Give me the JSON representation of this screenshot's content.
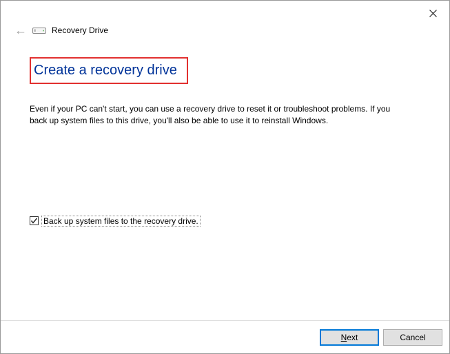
{
  "window": {
    "title": "Recovery Drive"
  },
  "page": {
    "heading": "Create a recovery drive",
    "description": "Even if your PC can't start, you can use a recovery drive to reset it or troubleshoot problems. If you back up system files to this drive, you'll also be able to use it to reinstall Windows.",
    "checkbox_label": "Back up system files to the recovery drive.",
    "checkbox_checked": true
  },
  "buttons": {
    "next_prefix": "N",
    "next_rest": "ext",
    "cancel": "Cancel"
  }
}
